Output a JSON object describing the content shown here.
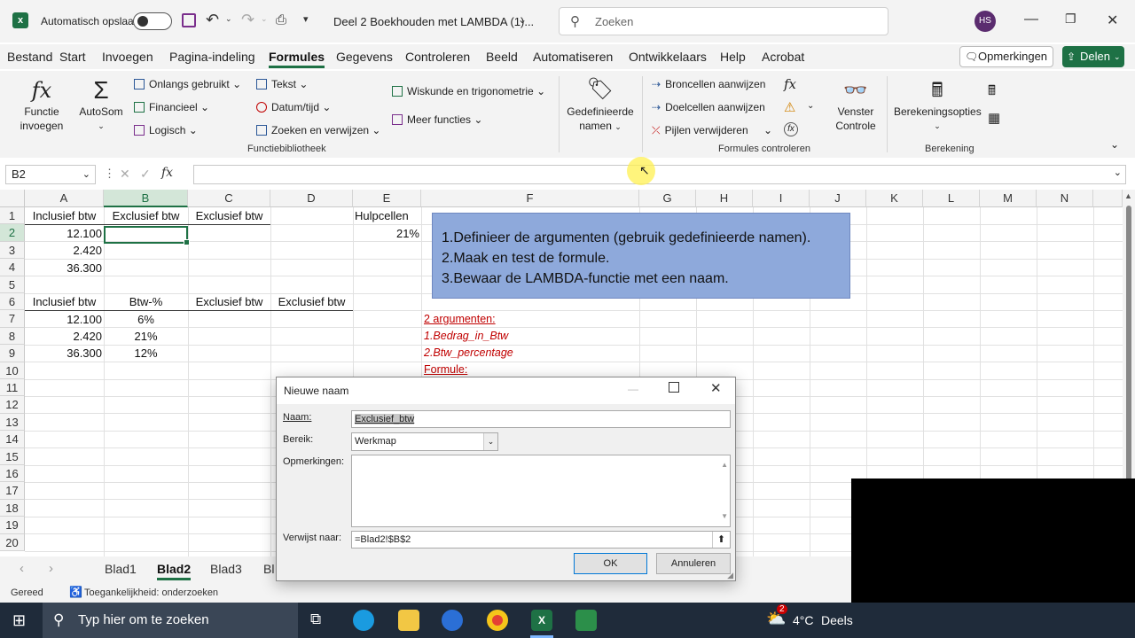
{
  "titlebar": {
    "autosave_label": "Automatisch opslaan",
    "doc_title": "Deel 2 Boekhouden met LAMBDA (1)...",
    "search_placeholder": "Zoeken",
    "avatar_initials": "HS"
  },
  "menubar": {
    "items": [
      "Bestand",
      "Start",
      "Invoegen",
      "Pagina-indeling",
      "Formules",
      "Gegevens",
      "Controleren",
      "Beeld",
      "Automatiseren",
      "Ontwikkelaars",
      "Help",
      "Acrobat"
    ],
    "active": "Formules",
    "comments_label": "Opmerkingen",
    "share_label": "Delen"
  },
  "ribbon": {
    "insert_function": [
      "Functie",
      "invoegen"
    ],
    "autosum": "AutoSom",
    "recently_used": "Onlangs gebruikt",
    "financial": "Financieel",
    "logical": "Logisch",
    "text": "Tekst",
    "datetime": "Datum/tijd",
    "lookup": "Zoeken en verwijzen",
    "math": "Wiskunde en trigonometrie",
    "more_functions": "Meer functies",
    "group_function_library": "Functiebibliotheek",
    "defined_names": [
      "Gedefinieerde",
      "namen"
    ],
    "trace_precedents": "Broncellen aanwijzen",
    "trace_dependents": "Doelcellen aanwijzen",
    "remove_arrows": "Pijlen verwijderen",
    "watch_window": [
      "Venster",
      "Controle"
    ],
    "group_formula_auditing": "Formules controleren",
    "calc_options": "Berekeningsopties",
    "group_calculation": "Berekening"
  },
  "formula_bar": {
    "name_box": "B2",
    "fx": "fx",
    "content": ""
  },
  "grid": {
    "columns": [
      "A",
      "B",
      "C",
      "D",
      "E",
      "F",
      "G",
      "H",
      "I",
      "J",
      "K",
      "L",
      "M",
      "N"
    ],
    "selected_column": "B",
    "rows": [
      "1",
      "2",
      "3",
      "4",
      "5",
      "6",
      "7",
      "8",
      "9",
      "10",
      "11",
      "12",
      "13",
      "14",
      "15",
      "16",
      "17",
      "18",
      "19",
      "20"
    ],
    "selected_row": "2",
    "cells": {
      "A1": "Inclusief btw",
      "B1": "Exclusief btw",
      "C1": "Exclusief btw",
      "E1": "Hulpcellen",
      "A2": "12.100",
      "E2": "21%",
      "A3": "2.420",
      "A4": "36.300",
      "A6": "Inclusief btw",
      "B6": "Btw-%",
      "C6": "Exclusief btw",
      "D6": "Exclusief btw",
      "A7": "12.100",
      "B7": "6%",
      "A8": "2.420",
      "B8": "21%",
      "A9": "36.300",
      "B9": "12%"
    },
    "instructions": [
      "1.Definieer de argumenten (gebruik gedefinieerde namen).",
      "2.Maak en test de formule.",
      "3.Bewaar de LAMBDA-functie met een naam."
    ],
    "notes": [
      "2 argumenten:",
      "1.Bedrag_in_Btw",
      "2.Btw_percentage",
      "Formule:"
    ]
  },
  "sheets": {
    "tabs": [
      "Blad1",
      "Blad2",
      "Blad3",
      "Bl"
    ],
    "active": "Blad2"
  },
  "status": {
    "ready": "Gereed",
    "accessibility": "Toegankelijkheid: onderzoeken"
  },
  "dialog": {
    "title": "Nieuwe naam",
    "name_label": "Naam:",
    "name_value": "Exclusief_btw",
    "scope_label": "Bereik:",
    "scope_value": "Werkmap",
    "comment_label": "Opmerkingen:",
    "refers_label": "Verwijst naar:",
    "refers_value": "=Blad2!$B$2",
    "ok_label": "OK",
    "cancel_label": "Annuleren"
  },
  "taskbar": {
    "search_placeholder": "Typ hier om te zoeken",
    "weather": "4°C",
    "weather_text": "Deels",
    "badge": "2"
  },
  "colors": {
    "excel_green": "#1e7145",
    "note_red": "#c00000",
    "instruction_box": "#8ea9db"
  }
}
